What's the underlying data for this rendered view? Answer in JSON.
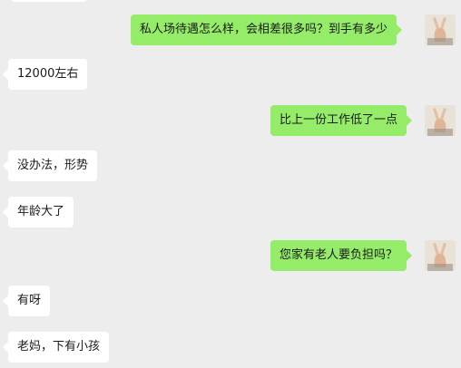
{
  "chat": {
    "messages": [
      {
        "side": "right",
        "text": "私人场待遇怎么样，会相差很多吗？到手有多少"
      },
      {
        "side": "left",
        "text": "12000左右"
      },
      {
        "side": "right",
        "text": "比上一份工作低了一点"
      },
      {
        "side": "left",
        "text": "没办法，形势"
      },
      {
        "side": "left",
        "text": "年龄大了"
      },
      {
        "side": "right",
        "text": "您家有老人要负担吗？"
      },
      {
        "side": "left",
        "text": "有呀"
      },
      {
        "side": "left",
        "text": "老妈，下有小孩"
      }
    ]
  },
  "colors": {
    "background": "#ededed",
    "outgoing_bubble": "#95ec69",
    "incoming_bubble": "#ffffff"
  },
  "icons": {
    "user_avatar": "victory-hand-avatar-icon"
  }
}
